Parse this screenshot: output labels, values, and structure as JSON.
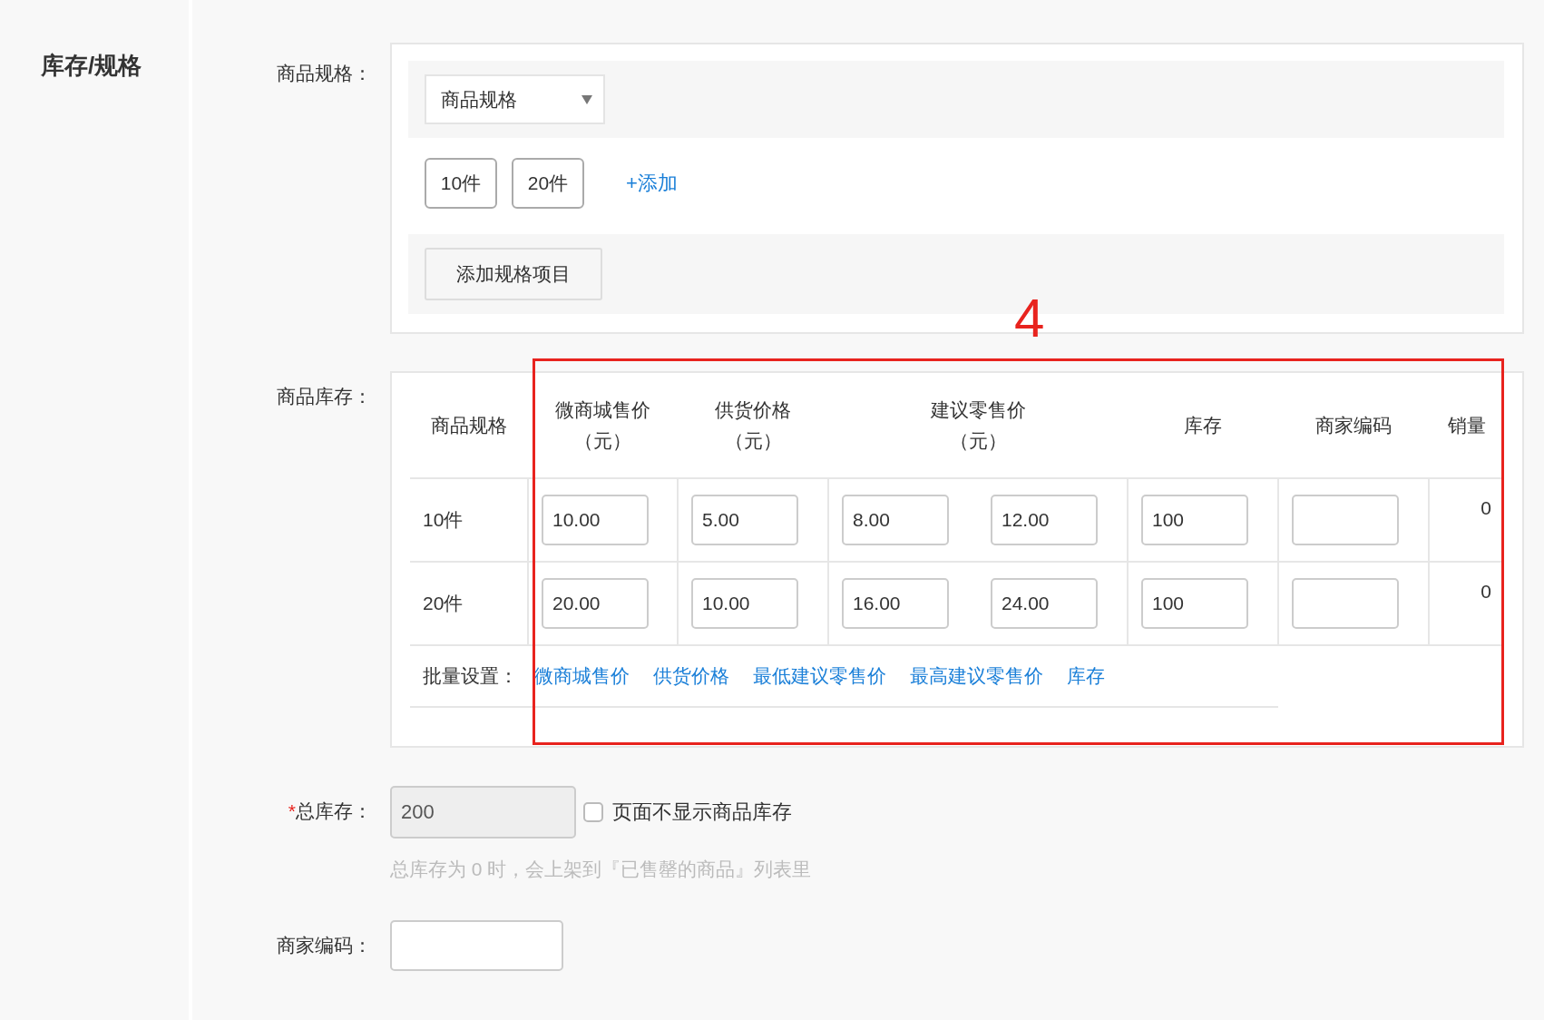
{
  "sidebar": {
    "title": "库存/规格"
  },
  "spec": {
    "label": "商品规格：",
    "dropdown": "商品规格",
    "values": [
      "10件",
      "20件"
    ],
    "add_link": "+添加",
    "add_button": "添加规格项目"
  },
  "stock": {
    "label": "商品库存：",
    "columns": [
      {
        "lines": [
          "商品规格"
        ],
        "kind": "single"
      },
      {
        "lines": [
          "微商城售价",
          "（元）"
        ],
        "kind": "single"
      },
      {
        "lines": [
          "供货价格",
          "（元）"
        ],
        "kind": "single"
      },
      {
        "lines": [
          "建议零售价",
          "（元）"
        ],
        "kind": "range"
      },
      {
        "lines": [
          "库存"
        ],
        "kind": "single"
      },
      {
        "lines": [
          "商家编码"
        ],
        "kind": "single"
      },
      {
        "lines": [
          "销量"
        ],
        "kind": "single"
      }
    ],
    "rows": [
      {
        "spec": "10件",
        "price": "10.00",
        "supply": "5.00",
        "min_retail": "8.00",
        "max_retail": "12.00",
        "stock": "100",
        "sales": "0"
      },
      {
        "spec": "20件",
        "price": "20.00",
        "supply": "10.00",
        "min_retail": "16.00",
        "max_retail": "24.00",
        "stock": "100",
        "sales": "0"
      }
    ],
    "batch": {
      "label": "批量设置：",
      "links": [
        "微商城售价",
        "供货价格",
        "最低建议零售价",
        "最高建议零售价",
        "库存"
      ]
    },
    "annotation": {
      "label": "4"
    }
  },
  "total": {
    "label": "总库存：",
    "required_mark": "*",
    "value": "200",
    "disabled": true,
    "checkbox": {
      "label": "页面不显示商品库存",
      "checked": false
    },
    "hint": "总库存为 0 时，会上架到『已售罄的商品』列表里"
  },
  "merchant_code": {
    "label": "商家编码："
  }
}
